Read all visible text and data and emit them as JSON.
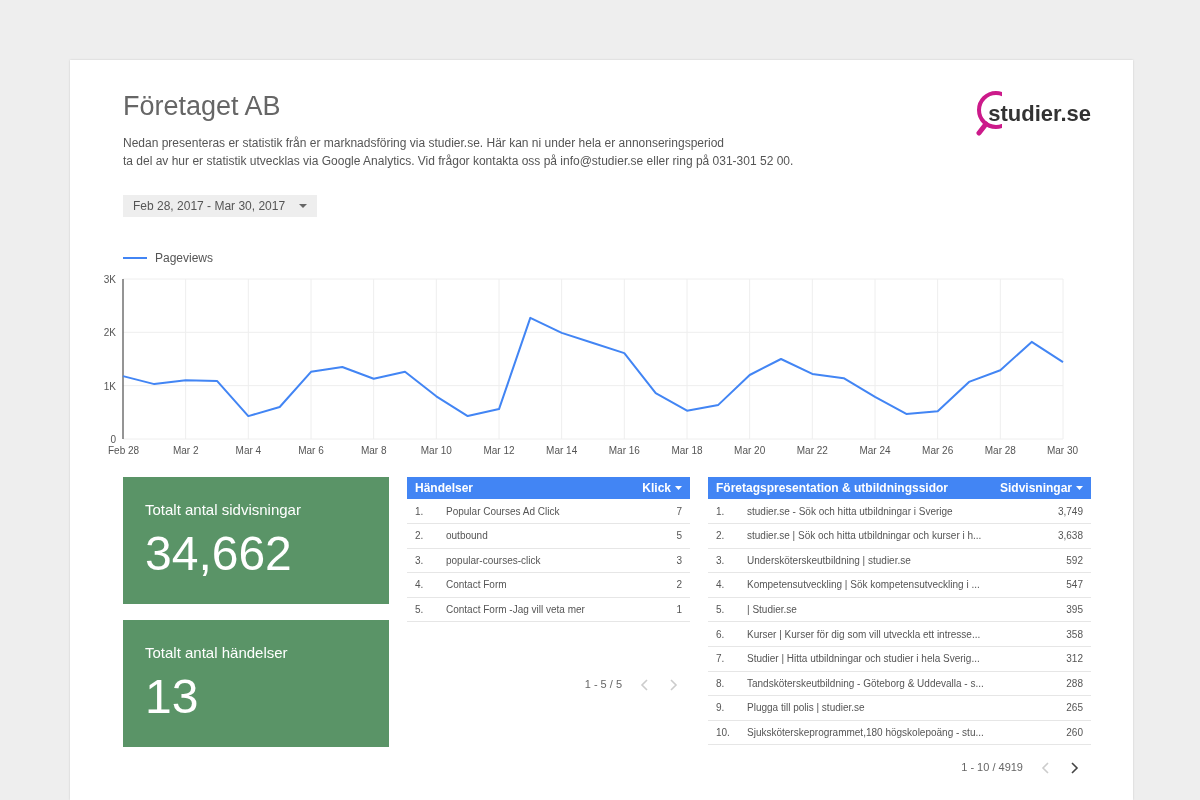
{
  "header": {
    "title": "Företaget AB",
    "logo_text": "studier.se",
    "description_lines": [
      "Nedan presenteras er statistik från er marknadsföring via studier.se. Här kan ni under hela er annonseringsperiod",
      "ta del av hur er statistik utvecklas via Google Analytics. Vid frågor kontakta oss på info@studier.se eller ring på 031-301 52 00."
    ]
  },
  "date_range": {
    "value": "Feb 28, 2017 - Mar 30, 2017"
  },
  "chart": {
    "chart_data": {
      "type": "line",
      "grid": true,
      "categories": [
        "Feb 28",
        null,
        "Mar 2",
        null,
        "Mar 4",
        null,
        "Mar 6",
        null,
        "Mar 8",
        null,
        "Mar 10",
        null,
        "Mar 12",
        null,
        "Mar 14",
        null,
        "Mar 16",
        null,
        "Mar 18",
        null,
        "Mar 20",
        null,
        "Mar 22",
        null,
        "Mar 24",
        null,
        "Mar 26",
        null,
        "Mar 28",
        null,
        "Mar 30"
      ],
      "ylim": [
        0,
        3000
      ],
      "yticks": [
        {
          "value": 0,
          "label": "0"
        },
        {
          "value": 1000,
          "label": "1K"
        },
        {
          "value": 2000,
          "label": "2K"
        },
        {
          "value": 3000,
          "label": "3K"
        }
      ],
      "series": [
        {
          "name": "Pageviews",
          "color": "#4285f4",
          "values": [
            1180,
            1030,
            1100,
            1090,
            430,
            600,
            1260,
            1350,
            1130,
            1260,
            800,
            430,
            560,
            2270,
            1990,
            1800,
            1610,
            860,
            530,
            640,
            1200,
            1500,
            1220,
            1140,
            790,
            470,
            520,
            1070,
            1290,
            1820,
            1440
          ]
        }
      ]
    }
  },
  "kpis": [
    {
      "label": "Totalt antal sidvisningar",
      "value": "34,662"
    },
    {
      "label": "Totalt antal händelser",
      "value": "13"
    }
  ],
  "tables": [
    {
      "columns": [
        "Händelser",
        "Klick"
      ],
      "rows": [
        {
          "rank": "1.",
          "name": "Popular Courses Ad Click",
          "value": "7"
        },
        {
          "rank": "2.",
          "name": "outbound",
          "value": "5"
        },
        {
          "rank": "3.",
          "name": "popular-courses-click",
          "value": "3"
        },
        {
          "rank": "4.",
          "name": "Contact Form",
          "value": "2"
        },
        {
          "rank": "5.",
          "name": "Contact Form -Jag vill veta mer",
          "value": "1"
        }
      ],
      "pagination": {
        "range": "1 - 5 / 5",
        "prev_disabled": true,
        "next_disabled": true
      }
    },
    {
      "columns": [
        "Företagspresentation & utbildningssidor",
        "Sidvisningar"
      ],
      "rows": [
        {
          "rank": "1.",
          "name": "studier.se - Sök och hitta utbildningar i Sverige",
          "value": "3,749"
        },
        {
          "rank": "2.",
          "name": "studier.se | Sök och hitta utbildningar och kurser i h...",
          "value": "3,638"
        },
        {
          "rank": "3.",
          "name": "Undersköterskeutbildning | studier.se",
          "value": "592"
        },
        {
          "rank": "4.",
          "name": "Kompetensutveckling | Sök kompetensutveckling i ...",
          "value": "547"
        },
        {
          "rank": "5.",
          "name": "| Studier.se",
          "value": "395"
        },
        {
          "rank": "6.",
          "name": "Kurser | Kurser för dig som vill utveckla ett intresse...",
          "value": "358"
        },
        {
          "rank": "7.",
          "name": "Studier | Hitta utbildningar och studier i hela Sverig...",
          "value": "312"
        },
        {
          "rank": "8.",
          "name": "Tandsköterskeutbildning - Göteborg & Uddevalla - s...",
          "value": "288"
        },
        {
          "rank": "9.",
          "name": "Plugga till polis | studier.se",
          "value": "265"
        },
        {
          "rank": "10.",
          "name": "Sjuksköterskeprogrammet,180 högskolepoäng - stu...",
          "value": "260"
        }
      ],
      "pagination": {
        "range": "1 - 10 / 4919",
        "prev_disabled": true,
        "next_disabled": false
      }
    }
  ]
}
